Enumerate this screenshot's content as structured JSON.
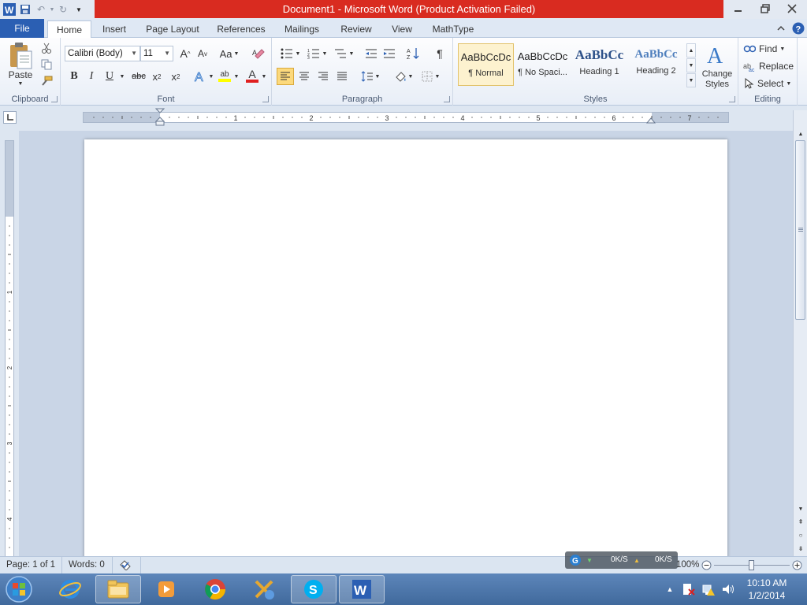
{
  "window": {
    "title": "Document1  -  Microsoft Word (Product Activation Failed)"
  },
  "tabs": {
    "file": "File",
    "items": [
      "Home",
      "Insert",
      "Page Layout",
      "References",
      "Mailings",
      "Review",
      "View",
      "MathType"
    ],
    "active": "Home"
  },
  "clipboard": {
    "paste": "Paste",
    "label": "Clipboard"
  },
  "font": {
    "name": "Calibri (Body)",
    "size": "11",
    "grow": "A",
    "shrink": "A",
    "change_case": "Aa",
    "bold": "B",
    "italic": "I",
    "underline": "U",
    "strike": "abc",
    "subscript": "x",
    "superscript": "x",
    "highlight": "ab",
    "font_color": "A",
    "label": "Font"
  },
  "paragraph": {
    "label": "Paragraph",
    "pilcrow": "¶"
  },
  "styles": {
    "items": [
      {
        "sample": "AaBbCcDc",
        "label": "¶ Normal"
      },
      {
        "sample": "AaBbCcDc",
        "label": "¶ No Spaci..."
      },
      {
        "sample": "AaBbCc",
        "label": "Heading 1"
      },
      {
        "sample": "AaBbCc",
        "label": "Heading 2"
      }
    ],
    "change_styles": "Change Styles",
    "label": "Styles"
  },
  "editing": {
    "find": "Find",
    "replace": "Replace",
    "select": "Select",
    "label": "Editing"
  },
  "ruler": {
    "marks": [
      "1",
      "2",
      "3",
      "4",
      "5",
      "6",
      "7"
    ],
    "vmarks": [
      "1",
      "2",
      "3",
      "4"
    ]
  },
  "status": {
    "page": "Page: 1 of 1",
    "words": "Words: 0",
    "zoom": "100%"
  },
  "netmeter": {
    "down": "0K/S",
    "up": "0K/S"
  },
  "taskbar": {
    "time": "10:10 AM",
    "date": "1/2/2014"
  },
  "colors": {
    "title_bar_red": "#d92b20",
    "file_tab_blue": "#2b5fb3",
    "selected_style_bg": "#fdf2cf",
    "font_color_swatch": "#e02020",
    "highlight_swatch": "#ffff00"
  }
}
